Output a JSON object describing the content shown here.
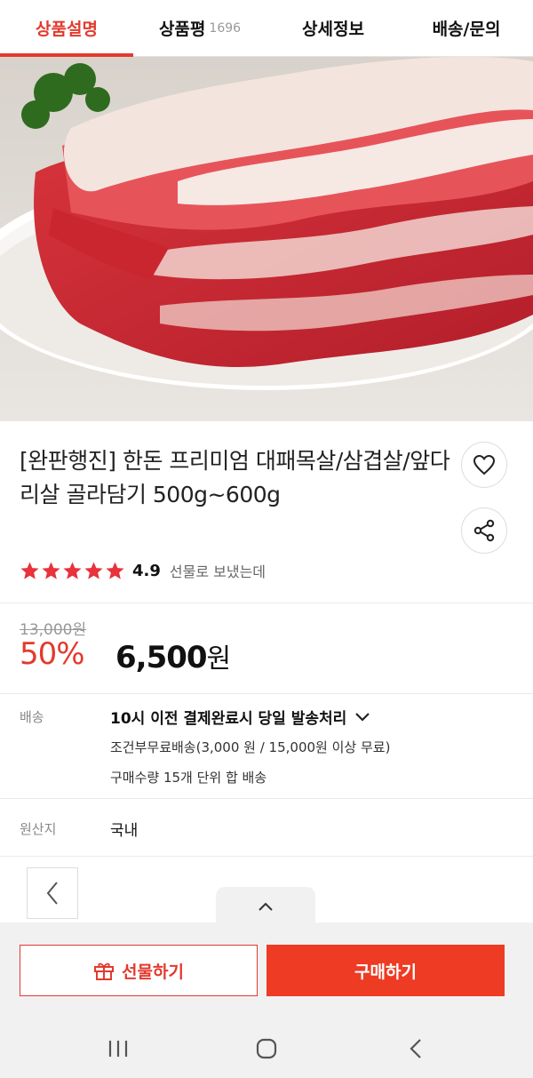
{
  "tabs": [
    {
      "label": "상품설명",
      "active": true
    },
    {
      "label": "상품평",
      "count": "1696"
    },
    {
      "label": "상세정보"
    },
    {
      "label": "배송/문의"
    }
  ],
  "product": {
    "title": "[완판행진] 한돈 프리미엄 대패목살/삼겹살/앞다리살 골라담기 500g~600g",
    "rating": "4.9",
    "rating_note": "선물로 보냈는데",
    "original_price": "13,000원",
    "discount": "50%",
    "price_value": "6,500",
    "price_unit": "원"
  },
  "shipping": {
    "label": "배송",
    "headline": "10시 이전 결제완료시 당일 발송처리",
    "condition": "조건부무료배송(3,000 원 / 15,000원 이상 무료)",
    "bundle": "구매수량 15개 단위 합 배송"
  },
  "origin": {
    "label": "원산지",
    "value": "국내"
  },
  "actions": {
    "gift_label": "선물하기",
    "buy_label": "구매하기"
  },
  "icons": {
    "wish": "heart-icon",
    "share": "share-icon",
    "prev": "chevron-left-icon",
    "up": "chevron-up-icon",
    "gift": "gift-icon"
  },
  "colors": {
    "accent": "#e23a2e",
    "buy_button": "#ee3b24",
    "star": "#e8323c"
  }
}
